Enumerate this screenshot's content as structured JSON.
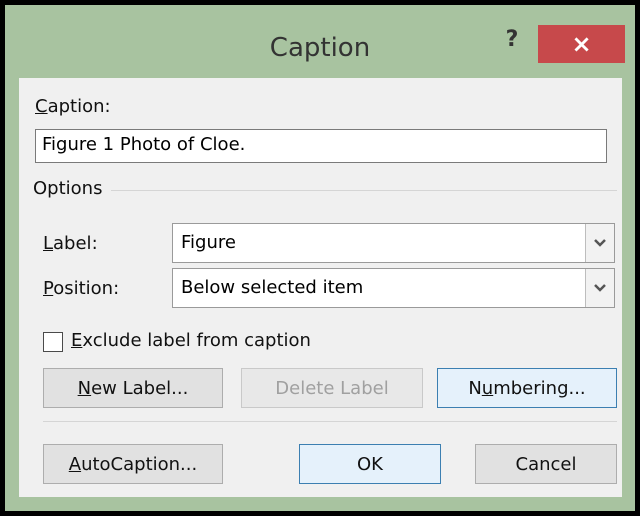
{
  "window": {
    "title": "Caption",
    "help_glyph": "?",
    "close_glyph": "×"
  },
  "caption": {
    "label": "Caption:",
    "label_accel": "C",
    "label_rest": "aption:",
    "value": "Figure 1 Photo of Cloe."
  },
  "options": {
    "group_label": "Options",
    "label_field": {
      "label_accel": "L",
      "label_rest": "abel:",
      "value": "Figure"
    },
    "position_field": {
      "label_accel": "P",
      "label_rest": "osition:",
      "value": "Below selected item"
    }
  },
  "exclude": {
    "accel": "E",
    "rest": "xclude label from caption",
    "checked": false
  },
  "buttons": {
    "new_label_accel": "N",
    "new_label_rest": "ew Label...",
    "delete_label": "Delete Label",
    "numbering_pre": "N",
    "numbering_accel": "u",
    "numbering_rest": "mbering...",
    "autocaption_accel": "A",
    "autocaption_rest": "utoCaption...",
    "ok": "OK",
    "cancel": "Cancel"
  },
  "icons": {
    "dropdown": "chevron-down-icon",
    "close": "close-icon",
    "help": "help-icon"
  },
  "colors": {
    "frame": "#a8c3a0",
    "close_button": "#c7494b",
    "client": "#f0f0f0",
    "default_button_border": "#3c7fb1"
  }
}
